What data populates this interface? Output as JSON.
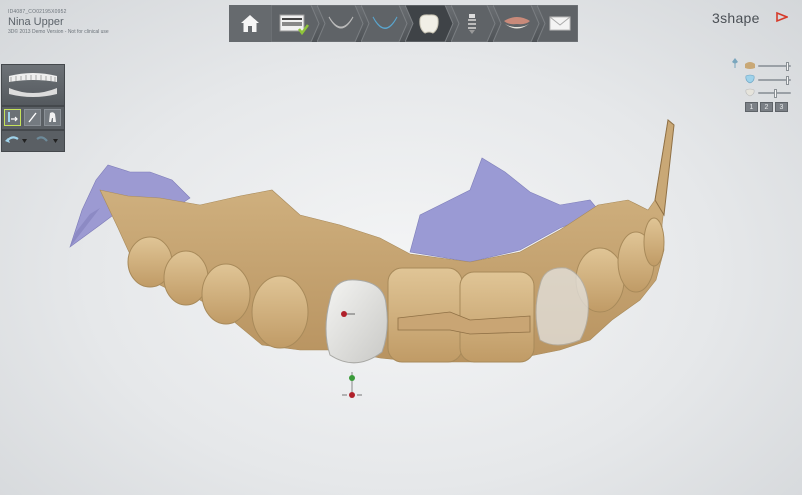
{
  "case": {
    "id": "ID4087_CO02195X0952",
    "name": "Nina Upper",
    "note": "3D© 2013 Demo Version - Not for clinical use"
  },
  "brand": {
    "name": "3shape",
    "accent": "#d63a2a"
  },
  "workflow": {
    "steps": [
      {
        "name": "home",
        "icon": "home-icon"
      },
      {
        "name": "order-form",
        "icon": "order-form-icon",
        "done": true
      },
      {
        "name": "scan-upper",
        "icon": "upper-jaw-icon"
      },
      {
        "name": "scan-lower",
        "icon": "lower-jaw-icon"
      },
      {
        "name": "crown-design",
        "icon": "crown-icon",
        "active": true
      },
      {
        "name": "implant",
        "icon": "implant-icon"
      },
      {
        "name": "bite",
        "icon": "bite-icon"
      },
      {
        "name": "send",
        "icon": "envelope-icon"
      }
    ],
    "colors": {
      "bar": "#5a5e62",
      "active": "#3f4347",
      "check": "#8fc43a"
    }
  },
  "left_tools": {
    "overview": "jaw-overview-icon",
    "tools": [
      "move-tool-icon",
      "pen-tool-icon",
      "tooth-tool-icon"
    ],
    "history": [
      "undo-icon",
      "redo-icon"
    ]
  },
  "view_controls": {
    "sliders": [
      {
        "name": "antagonist-transparency",
        "icon": "jaw-model-icon",
        "level": 0.95
      },
      {
        "name": "prep-transparency",
        "icon": "prep-icon",
        "level": 0.95
      },
      {
        "name": "restoration-transparency",
        "icon": "crown-small-icon",
        "level": 0.55
      }
    ],
    "buttons": [
      "1",
      "2",
      "3"
    ]
  },
  "scene": {
    "gum_color": "#c9a876",
    "tissue_color": "#9a9ad0",
    "crown_color": "#e2e2e0"
  }
}
